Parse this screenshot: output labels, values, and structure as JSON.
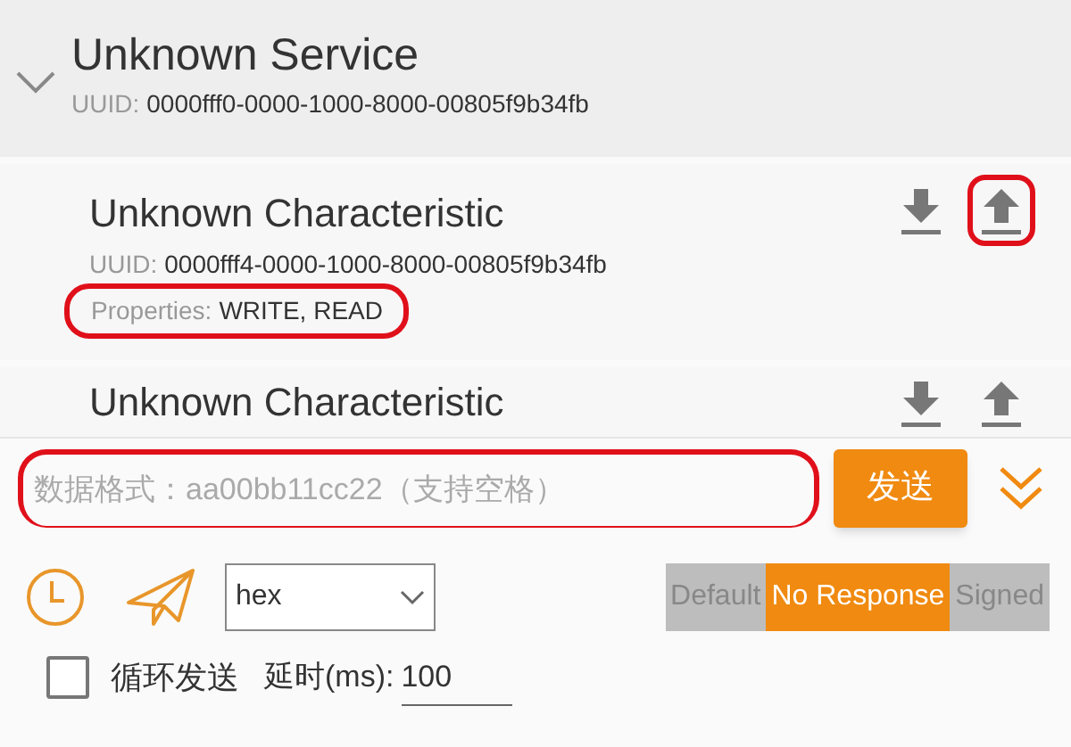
{
  "service": {
    "title": "Unknown Service",
    "expanded": true,
    "uuid_label": "UUID:",
    "uuid": "0000fff0-0000-1000-8000-00805f9b34fb"
  },
  "characteristics": [
    {
      "title": "Unknown Characteristic",
      "uuid_label": "UUID:",
      "uuid": "0000fff4-0000-1000-8000-00805f9b34fb",
      "properties_label": "Properties:",
      "properties": "WRITE, READ",
      "properties_highlighted": true,
      "write_highlighted": true
    },
    {
      "title": "Unknown Characteristic",
      "write_highlighted": false
    }
  ],
  "send_panel": {
    "input": {
      "placeholder": "数据格式：aa00bb11cc22（支持空格）",
      "highlighted": true
    },
    "send_button": "发送",
    "format_select": {
      "value": "hex"
    },
    "write_types": [
      {
        "label": "Default",
        "selected": false
      },
      {
        "label": "No Response",
        "selected": true
      },
      {
        "label": "Signed",
        "selected": false
      }
    ],
    "loop_send": {
      "label": "循环发送",
      "checked": false
    },
    "delay": {
      "label": "延时(ms):",
      "value": "100"
    }
  }
}
